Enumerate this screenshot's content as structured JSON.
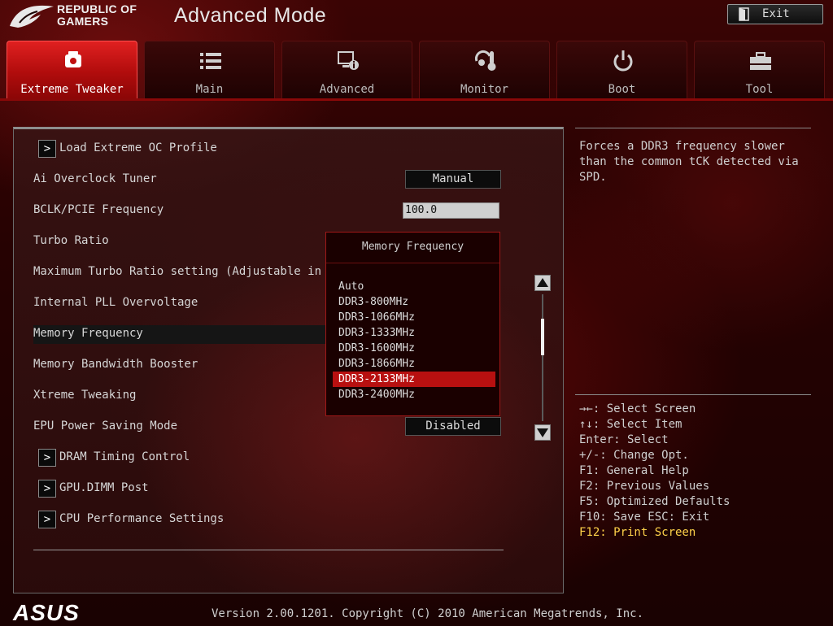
{
  "header": {
    "brand_line1": "REPUBLIC OF",
    "brand_line2": "GAMERS",
    "mode_title": "Advanced Mode",
    "exit_label": "Exit"
  },
  "tabs": [
    {
      "label": "Extreme Tweaker",
      "icon": "tweaker-icon",
      "active": true
    },
    {
      "label": "Main",
      "icon": "list-icon"
    },
    {
      "label": "Advanced",
      "icon": "advanced-icon"
    },
    {
      "label": "Monitor",
      "icon": "thermometer-icon"
    },
    {
      "label": "Boot",
      "icon": "power-icon"
    },
    {
      "label": "Tool",
      "icon": "toolbox-icon"
    }
  ],
  "settings": {
    "load_profile": "Load Extreme OC Profile",
    "ai_overclock_tuner": {
      "label": "Ai Overclock Tuner",
      "value": "Manual"
    },
    "bclk": {
      "label": "BCLK/PCIE Frequency",
      "value": "100.0"
    },
    "turbo_ratio": {
      "label": "Turbo Ratio"
    },
    "max_turbo": {
      "label": "Maximum Turbo Ratio setting (Adjustable in O"
    },
    "internal_pll": {
      "label": "Internal PLL Overvoltage"
    },
    "memory_frequency": {
      "label": "Memory Frequency"
    },
    "memory_bandwidth": {
      "label": "Memory Bandwidth Booster"
    },
    "xtreme_tweaking": {
      "label": "Xtreme Tweaking"
    },
    "epu_power": {
      "label": "EPU Power Saving Mode",
      "value": "Disabled"
    },
    "dram_timing": "DRAM Timing Control",
    "gpu_dimm": "GPU.DIMM Post",
    "cpu_perf": "CPU Performance Settings"
  },
  "popup": {
    "title": "Memory Frequency",
    "options": [
      "Auto",
      "DDR3-800MHz",
      "DDR3-1066MHz",
      "DDR3-1333MHz",
      "DDR3-1600MHz",
      "DDR3-1866MHz",
      "DDR3-2133MHz",
      "DDR3-2400MHz"
    ],
    "highlighted": "DDR3-2133MHz"
  },
  "help": {
    "description": "Forces a DDR3 frequency slower than the common tCK detected via SPD.",
    "keys": [
      "→←: Select Screen",
      "↑↓: Select Item",
      "Enter: Select",
      "+/-: Change Opt.",
      "F1: General Help",
      "F2: Previous Values",
      "F5: Optimized Defaults",
      "F10: Save  ESC: Exit"
    ],
    "print_screen": "F12: Print Screen"
  },
  "footer": {
    "logo": "ASUS",
    "version": "Version 2.00.1201. Copyright (C) 2010 American Megatrends, Inc."
  },
  "colors": {
    "accent_red": "#d01818",
    "highlight_red": "#b81010",
    "gold": "#ffd24a"
  }
}
